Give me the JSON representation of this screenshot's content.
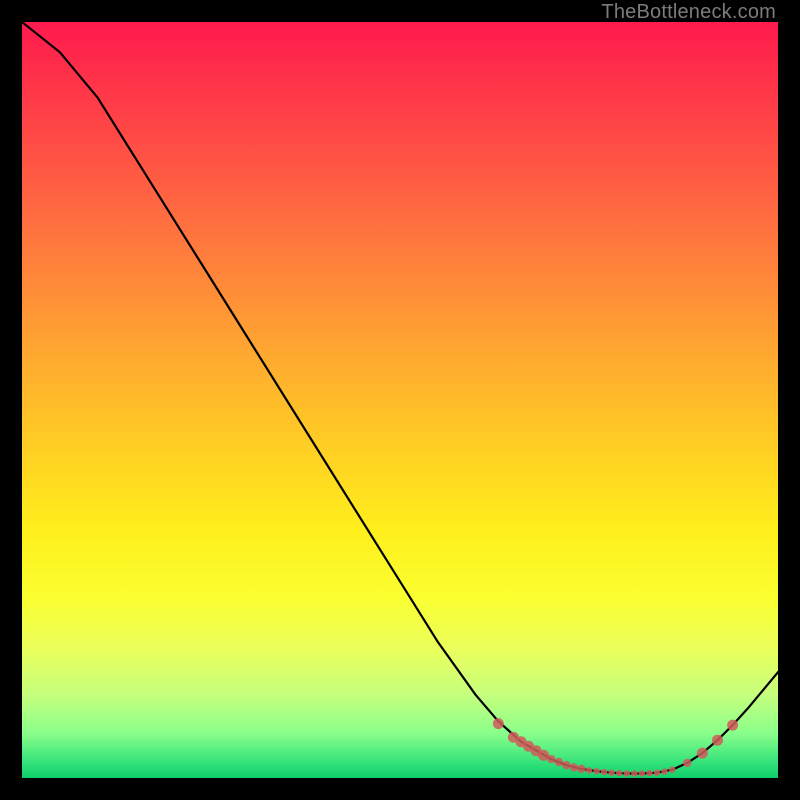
{
  "watermark": "TheBottleneck.com",
  "chart_data": {
    "type": "line",
    "title": "",
    "xlabel": "",
    "ylabel": "",
    "xlim": [
      0,
      100
    ],
    "ylim": [
      0,
      100
    ],
    "grid": false,
    "series": [
      {
        "name": "curve",
        "x": [
          0,
          5,
          10,
          15,
          20,
          25,
          30,
          35,
          40,
          45,
          50,
          55,
          60,
          63,
          66,
          70,
          72,
          74,
          76,
          78,
          80,
          82,
          84,
          86,
          88,
          90,
          92,
          94,
          96,
          98,
          100
        ],
        "y": [
          100,
          96,
          90,
          82,
          74,
          66,
          58,
          50,
          42,
          34,
          26,
          18,
          11,
          7.5,
          4.8,
          2.5,
          1.7,
          1.2,
          0.9,
          0.7,
          0.6,
          0.6,
          0.7,
          1.1,
          2.0,
          3.3,
          5.0,
          7.0,
          9.2,
          11.6,
          14.0
        ]
      }
    ],
    "markers": {
      "name": "highlight-points",
      "color": "#d05a5a",
      "x": [
        63,
        65,
        66,
        67,
        68,
        69,
        70,
        71,
        72,
        73,
        74,
        75,
        76,
        77,
        78,
        79,
        80,
        81,
        82,
        83,
        84,
        85,
        86,
        88,
        90,
        92,
        94
      ],
      "y": [
        7.2,
        5.4,
        4.8,
        4.2,
        3.6,
        3.0,
        2.5,
        2.1,
        1.7,
        1.4,
        1.2,
        1.0,
        0.9,
        0.8,
        0.7,
        0.65,
        0.6,
        0.6,
        0.6,
        0.65,
        0.7,
        0.85,
        1.1,
        2.0,
        3.3,
        5.0,
        7.0
      ]
    }
  }
}
